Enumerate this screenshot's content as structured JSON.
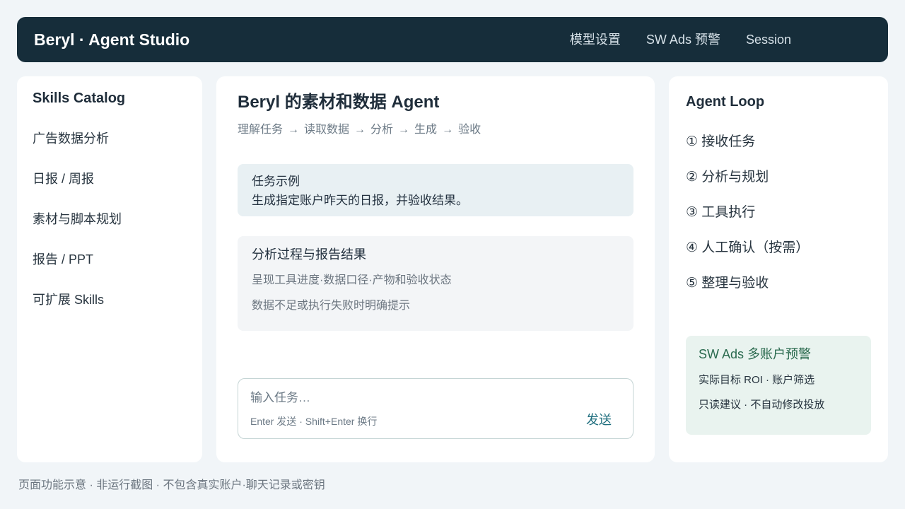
{
  "header": {
    "brand": "Beryl · Agent Studio",
    "nav": [
      "模型设置",
      "SW Ads 预警",
      "Session"
    ]
  },
  "sidebar": {
    "title": "Skills Catalog",
    "items": [
      "广告数据分析",
      "日报 / 周报",
      "素材与脚本规划",
      "报告 / PPT",
      "可扩展 Skills"
    ]
  },
  "main": {
    "title": "Beryl 的素材和数据 Agent",
    "flow": [
      "理解任务",
      "读取数据",
      "分析",
      "生成",
      "验收"
    ],
    "flow_arrow": "→",
    "example": {
      "label": "任务示例",
      "text": "生成指定账户昨天的日报，并验收结果。"
    },
    "analysis": {
      "title": "分析过程与报告结果",
      "line1": "呈现工具进度·数据口径·产物和验收状态",
      "line2": "数据不足或执行失败时明确提示"
    },
    "input": {
      "placeholder": "输入任务…",
      "hint": "Enter 发送 · Shift+Enter 换行",
      "send_label": "发送"
    }
  },
  "agent_loop": {
    "title": "Agent Loop",
    "steps": [
      "① 接收任务",
      "② 分析与规划",
      "③ 工具执行",
      "④ 人工确认（按需）",
      "⑤ 整理与验收"
    ]
  },
  "alert": {
    "title": "SW Ads 多账户预警",
    "line1": "实际目标 ROI · 账户筛选",
    "line2": "只读建议 · 不自动修改投放"
  },
  "footer": {
    "text": "页面功能示意 · 非运行截图 · 不包含真实账户·聊天记录或密钥"
  },
  "colors": {
    "topbar": "#162d3a",
    "background": "#f1f5f8",
    "example_card": "#e8f0f3",
    "alert_card": "#e9f3ef",
    "send_accent": "#1f6e7e"
  }
}
